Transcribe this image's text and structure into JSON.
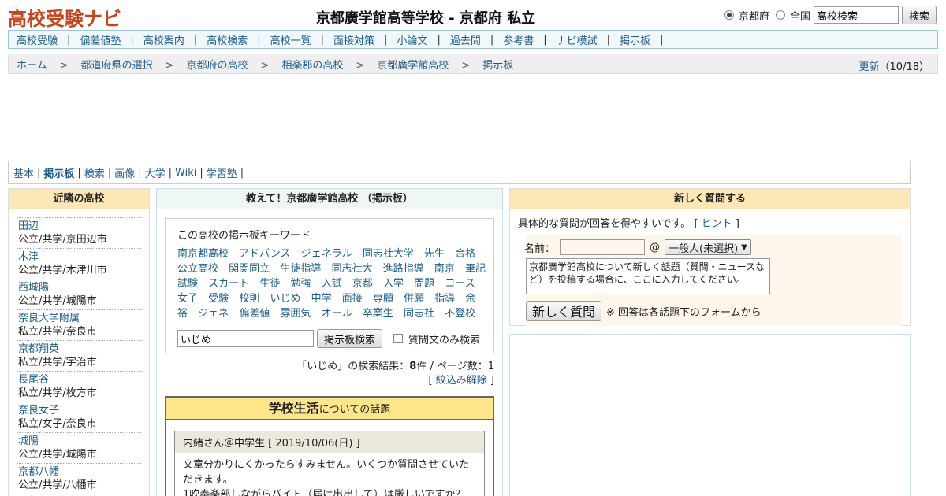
{
  "header": {
    "logo": "高校受験ナビ",
    "title": "京都廣学館高等学校 - 京都府 私立",
    "scope_options": [
      "京都府",
      "全国"
    ],
    "scope_selected": "京都府",
    "search_value": "高校検索",
    "search_button": "検索"
  },
  "nav": {
    "items": [
      "高校受験",
      "偏差値塾",
      "高校案内",
      "高校検索",
      "高校一覧",
      "面接対策",
      "小論文",
      "過去問",
      "参考書",
      "ナビ模試",
      "掲示板"
    ],
    "separator": "|"
  },
  "breadcrumb": {
    "items": [
      "ホーム",
      "都道府県の選択",
      "京都府の高校",
      "相楽郡の高校",
      "京都廣学館高校",
      "掲示板"
    ],
    "separator": ">",
    "update_link": "更新",
    "update_date": "（10/18）"
  },
  "tabs": {
    "items": [
      "基本",
      "掲示板",
      "検索",
      "画像",
      "大学",
      "Wiki",
      "学習塾"
    ],
    "active": "掲示板"
  },
  "nearby": {
    "title": "近隣の高校",
    "schools": [
      {
        "name": "田辺",
        "info": "公立/共学/京田辺市"
      },
      {
        "name": "木津",
        "info": "公立/共学/木津川市"
      },
      {
        "name": "西城陽",
        "info": "公立/共学/城陽市"
      },
      {
        "name": "奈良大学附属",
        "info": "私立/共学/奈良市"
      },
      {
        "name": "京都翔英",
        "info": "私立/共学/宇治市"
      },
      {
        "name": "長尾谷",
        "info": "私立/共学/枚方市"
      },
      {
        "name": "奈良女子",
        "info": "私立/女子/奈良市"
      },
      {
        "name": "城陽",
        "info": "公立/共学/城陽市"
      },
      {
        "name": "京都八幡",
        "info": "公立/共学/八幡市"
      }
    ]
  },
  "board": {
    "title": "教えて！京都廣学館高校 （掲示板）",
    "keyword_title": "この高校の掲示板キーワード",
    "keywords": [
      "南京都高校",
      "アドバンス",
      "ジェネラル",
      "同志社大学",
      "先生",
      "合格",
      "公立高校",
      "関関同立",
      "生徒指導",
      "同志社大",
      "進路指導",
      "南京",
      "筆記試験",
      "スカート",
      "生徒",
      "勉強",
      "入試",
      "京都",
      "入学",
      "問題",
      "コース",
      "女子",
      "受験",
      "校則",
      "いじめ",
      "中学",
      "面接",
      "専願",
      "併願",
      "指導",
      "余裕",
      "ジェネ",
      "偏差値",
      "雰囲気",
      "オール",
      "卒業生",
      "同志社",
      "不登校"
    ],
    "search_value": "いじめ",
    "search_button": "掲示板検索",
    "checkbox_label": "質問文のみ検索",
    "result_query": "「いじめ」の検索結果：",
    "result_count": "8",
    "result_suffix": "件 / ページ数：1",
    "clear_filter": "絞込み解除",
    "topic_category": "学校生活",
    "topic_suffix": "についての話題",
    "post_header": "内緒さん＠中学生 [ 2019/10/06(日) ]",
    "post_body": "文章分かりにくかったらすみません。いくつか質問させていただきます。\n1吹奏楽部しながらバイト（届け出出して）は厳しいですか？"
  },
  "ask": {
    "title": "新しく質問する",
    "tip": "具体的な質問が回答を得やすいです。 [",
    "hint_link": "ヒント",
    "tip_end": "]",
    "name_label": "名前：",
    "at": "@",
    "role_selected": "一般人(未選択)",
    "textarea_placeholder": "京都廣学館高校について新しく話題（質問・ニュースなど）を投稿する場合に、ここに入力してください。",
    "submit_label": "新しく質問",
    "note": "※ 回答は各話題下のフォームから"
  }
}
